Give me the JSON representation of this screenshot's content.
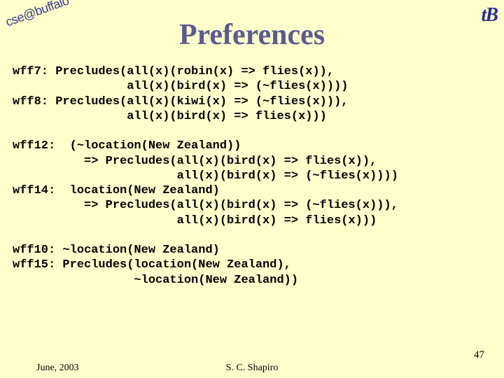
{
  "header": {
    "corner_text": "cse@buffalo",
    "ub_logo_text": "UB",
    "title": "Preferences"
  },
  "body": {
    "block1": "wff7: Precludes(all(x)(robin(x) => flies(x)),\n                all(x)(bird(x) => (~flies(x))))\nwff8: Precludes(all(x)(kiwi(x) => (~flies(x))),\n                all(x)(bird(x) => flies(x)))",
    "block2": "wff12:  (~location(New Zealand))\n          => Precludes(all(x)(bird(x) => flies(x)),\n                       all(x)(bird(x) => (~flies(x))))\nwff14:  location(New Zealand)\n          => Precludes(all(x)(bird(x) => (~flies(x))),\n                       all(x)(bird(x) => flies(x)))",
    "block3": "wff10: ~location(New Zealand)\nwff15: Precludes(location(New Zealand),\n                 ~location(New Zealand))"
  },
  "footer": {
    "date": "June, 2003",
    "author": "S. C. Shapiro",
    "page": "47"
  }
}
